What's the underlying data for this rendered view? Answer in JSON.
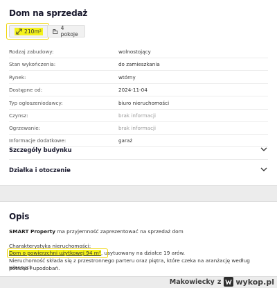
{
  "listing": {
    "title": "Dom na sprzedaż",
    "chips": {
      "area": "210m²",
      "rooms": "4 pokoje",
      "area_icon": "area-icon",
      "rooms_icon": "floorplan-icon"
    },
    "details": [
      {
        "key": "Rodzaj zabudowy:",
        "value": "wolnostojący",
        "muted": false
      },
      {
        "key": "Stan wykończenia:",
        "value": "do zamieszkania",
        "muted": false
      },
      {
        "key": "Rynek:",
        "value": "wtórny",
        "muted": false
      },
      {
        "key": "Dostępne od:",
        "value": "2024-11-04",
        "muted": false
      },
      {
        "key": "Typ ogłoszeniodawcy:",
        "value": "biuro nieruchomości",
        "muted": false
      },
      {
        "key": "Czynsz:",
        "value": "brak informacji",
        "muted": true
      },
      {
        "key": "Ogrzewanie:",
        "value": "brak informacji",
        "muted": true
      },
      {
        "key": "Informacje dodatkowe:",
        "value": "garaż",
        "muted": false
      }
    ],
    "accordions": [
      {
        "label": "Szczegóły budynku",
        "icon": "chevron-down-icon"
      },
      {
        "label": "Działka i otoczenie",
        "icon": "chevron-down-icon"
      }
    ]
  },
  "description": {
    "title": "Opis",
    "intro_bold": "SMART Property",
    "intro_rest": " ma przyjemność zaprezentować na sprzedaż dom",
    "section_heading": "Charakterystyka nieruchomości:",
    "line1_highlight": "Dom o powierzchni użytkowej 94 m²",
    "line1_rest": ", usytuowany na działce 19 arów.",
    "line2": "Nieruchomość składa się z przestronnego parteru oraz piętra, które czeka na aranżację według własnych",
    "line3": "potrzeb i upodobań."
  },
  "watermark": {
    "user": "Makowiecky",
    "separator": "z",
    "site": "wykop.pl",
    "logo_icon": "wykop-logo-icon"
  },
  "colors": {
    "highlight": "#f4f21a",
    "card_bg": "#ffffff",
    "page_bg": "#ececec"
  }
}
